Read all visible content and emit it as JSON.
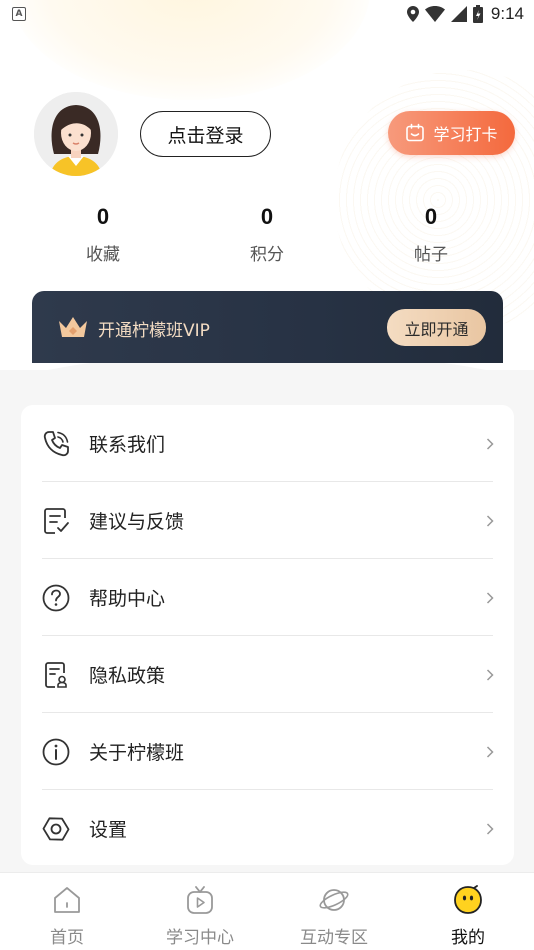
{
  "status_bar": {
    "time": "9:14",
    "left_icon": "A",
    "icons": [
      "location-icon",
      "wifi-icon",
      "signal-icon",
      "battery-icon"
    ]
  },
  "profile": {
    "avatar_icon": "girl-avatar",
    "login_label": "点击登录",
    "checkin_label": "学习打卡"
  },
  "stats": [
    {
      "value": "0",
      "label": "收藏"
    },
    {
      "value": "0",
      "label": "积分"
    },
    {
      "value": "0",
      "label": "帖子"
    }
  ],
  "vip": {
    "title": "开通柠檬班VIP",
    "button_label": "立即开通"
  },
  "menu": [
    {
      "label": "联系我们",
      "icon": "phone-icon"
    },
    {
      "label": "建议与反馈",
      "icon": "feedback-icon"
    },
    {
      "label": "帮助中心",
      "icon": "help-icon"
    },
    {
      "label": "隐私政策",
      "icon": "privacy-icon"
    },
    {
      "label": "关于柠檬班",
      "icon": "info-icon"
    },
    {
      "label": "设置",
      "icon": "settings-icon"
    }
  ],
  "bottom_nav": [
    {
      "label": "首页",
      "icon": "home-icon",
      "active": false
    },
    {
      "label": "学习中心",
      "icon": "study-tv-icon",
      "active": false
    },
    {
      "label": "互动专区",
      "icon": "planet-icon",
      "active": false
    },
    {
      "label": "我的",
      "icon": "lemon-face-icon",
      "active": true
    }
  ],
  "colors": {
    "accent_orange": "#f4693d",
    "vip_dark": "#2a3445",
    "vip_gold": "#f3dcc3",
    "active_yellow": "#ffd21f"
  }
}
